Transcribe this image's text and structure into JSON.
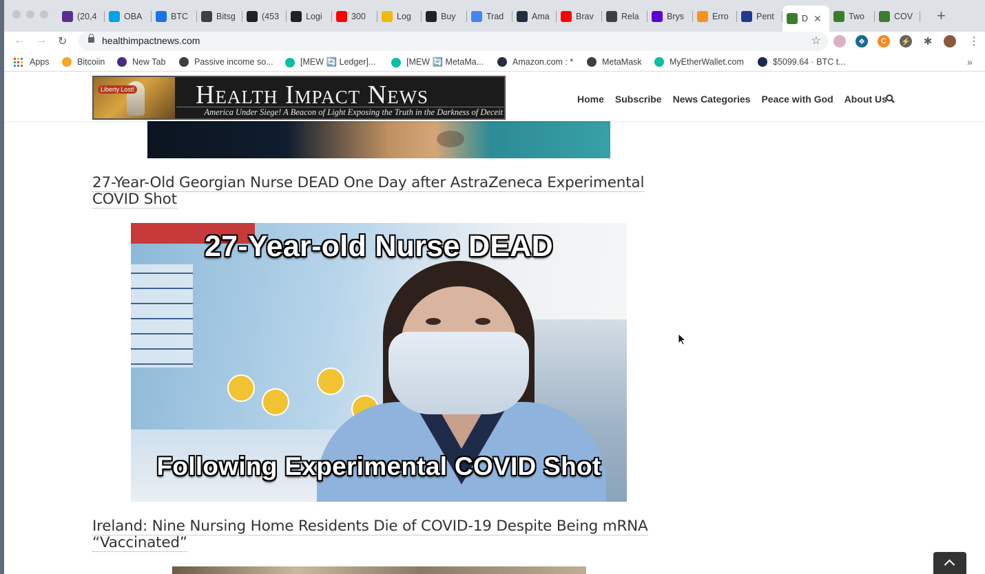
{
  "browser": {
    "tabs": [
      {
        "label": "(20,4",
        "icon": "mail-icon",
        "color": "#5c2d91"
      },
      {
        "label": "OBA",
        "icon": "tba-icon",
        "color": "#00a2e8"
      },
      {
        "label": "BTC",
        "icon": "cloud-icon",
        "color": "#1a73e8"
      },
      {
        "label": "Bitsg",
        "icon": "globe-icon",
        "color": "#3c4043"
      },
      {
        "label": "(453",
        "icon": "app-icon",
        "color": "#202124"
      },
      {
        "label": "Logi",
        "icon": "app-icon",
        "color": "#202124"
      },
      {
        "label": "300",
        "icon": "youtube-icon",
        "color": "#ff0000"
      },
      {
        "label": "Log",
        "icon": "binance-icon",
        "color": "#f0b90b"
      },
      {
        "label": "Buy",
        "icon": "s-icon",
        "color": "#202124"
      },
      {
        "label": "Trad",
        "icon": "docs-icon",
        "color": "#4285f4"
      },
      {
        "label": "Ama",
        "icon": "amazon-icon",
        "color": "#232f3e"
      },
      {
        "label": "Brav",
        "icon": "youtube-icon",
        "color": "#ff0000"
      },
      {
        "label": "Rela",
        "icon": "swirl-icon",
        "color": "#3c4043"
      },
      {
        "label": "Brys",
        "icon": "yahoo-icon",
        "color": "#6001d2"
      },
      {
        "label": "Erro",
        "icon": "coin-icon",
        "color": "#f7931a"
      },
      {
        "label": "Pent",
        "icon": "sp-icon",
        "color": "#1f3a93"
      },
      {
        "label": "D",
        "icon": "leaf-icon",
        "color": "#3a7d2c",
        "active": true
      },
      {
        "label": "Two",
        "icon": "leaf-icon",
        "color": "#3a7d2c"
      },
      {
        "label": "COV",
        "icon": "leaf-icon",
        "color": "#3a7d2c"
      }
    ],
    "url": "healthimpactnews.com",
    "bookmarks": [
      {
        "label": "Apps",
        "icon": "apps-grid-icon"
      },
      {
        "label": "Bitcoiin",
        "icon": "bitcoiin-icon",
        "color": "#f5a623"
      },
      {
        "label": "New Tab",
        "icon": "newtab-icon",
        "color": "#4b2a85"
      },
      {
        "label": "Passive income so...",
        "icon": "globe-icon",
        "color": "#3c4043"
      },
      {
        "label": "[MEW 🔄 Ledger]...",
        "icon": "mew-icon",
        "color": "#05c0a5"
      },
      {
        "label": "[MEW 🔄 MetaMa...",
        "icon": "mew-icon",
        "color": "#05c0a5"
      },
      {
        "label": "Amazon.com : *",
        "icon": "amazon-icon",
        "color": "#232f3e"
      },
      {
        "label": "MetaMask",
        "icon": "globe-icon",
        "color": "#3c4043"
      },
      {
        "label": "MyEtherWallet.com",
        "icon": "mew-icon",
        "color": "#05c0a5"
      },
      {
        "label": "$5099.64 · BTC t...",
        "icon": "chart-icon",
        "color": "#1b2a4a"
      }
    ]
  },
  "site": {
    "logo_badge": "Liberty Lost!",
    "logo_title": "Health Impact News",
    "logo_tagline": "America Under Siege! A Beacon of Light Exposing the Truth in the Darkness of Deceit",
    "nav": [
      "Home",
      "Subscribe",
      "News Categories",
      "Peace with God",
      "About Us"
    ]
  },
  "articles": [
    {
      "headline": "27-Year-Old Georgian Nurse DEAD One Day after AstraZeneca Experimental COVID Shot",
      "image_caption_top": "27-Year-old Nurse DEAD",
      "image_caption_bottom": "Following Experimental COVID Shot"
    },
    {
      "headline": "Ireland: Nine Nursing Home Residents Die of COVID-19 Despite Being mRNA “Vaccinated”"
    }
  ]
}
